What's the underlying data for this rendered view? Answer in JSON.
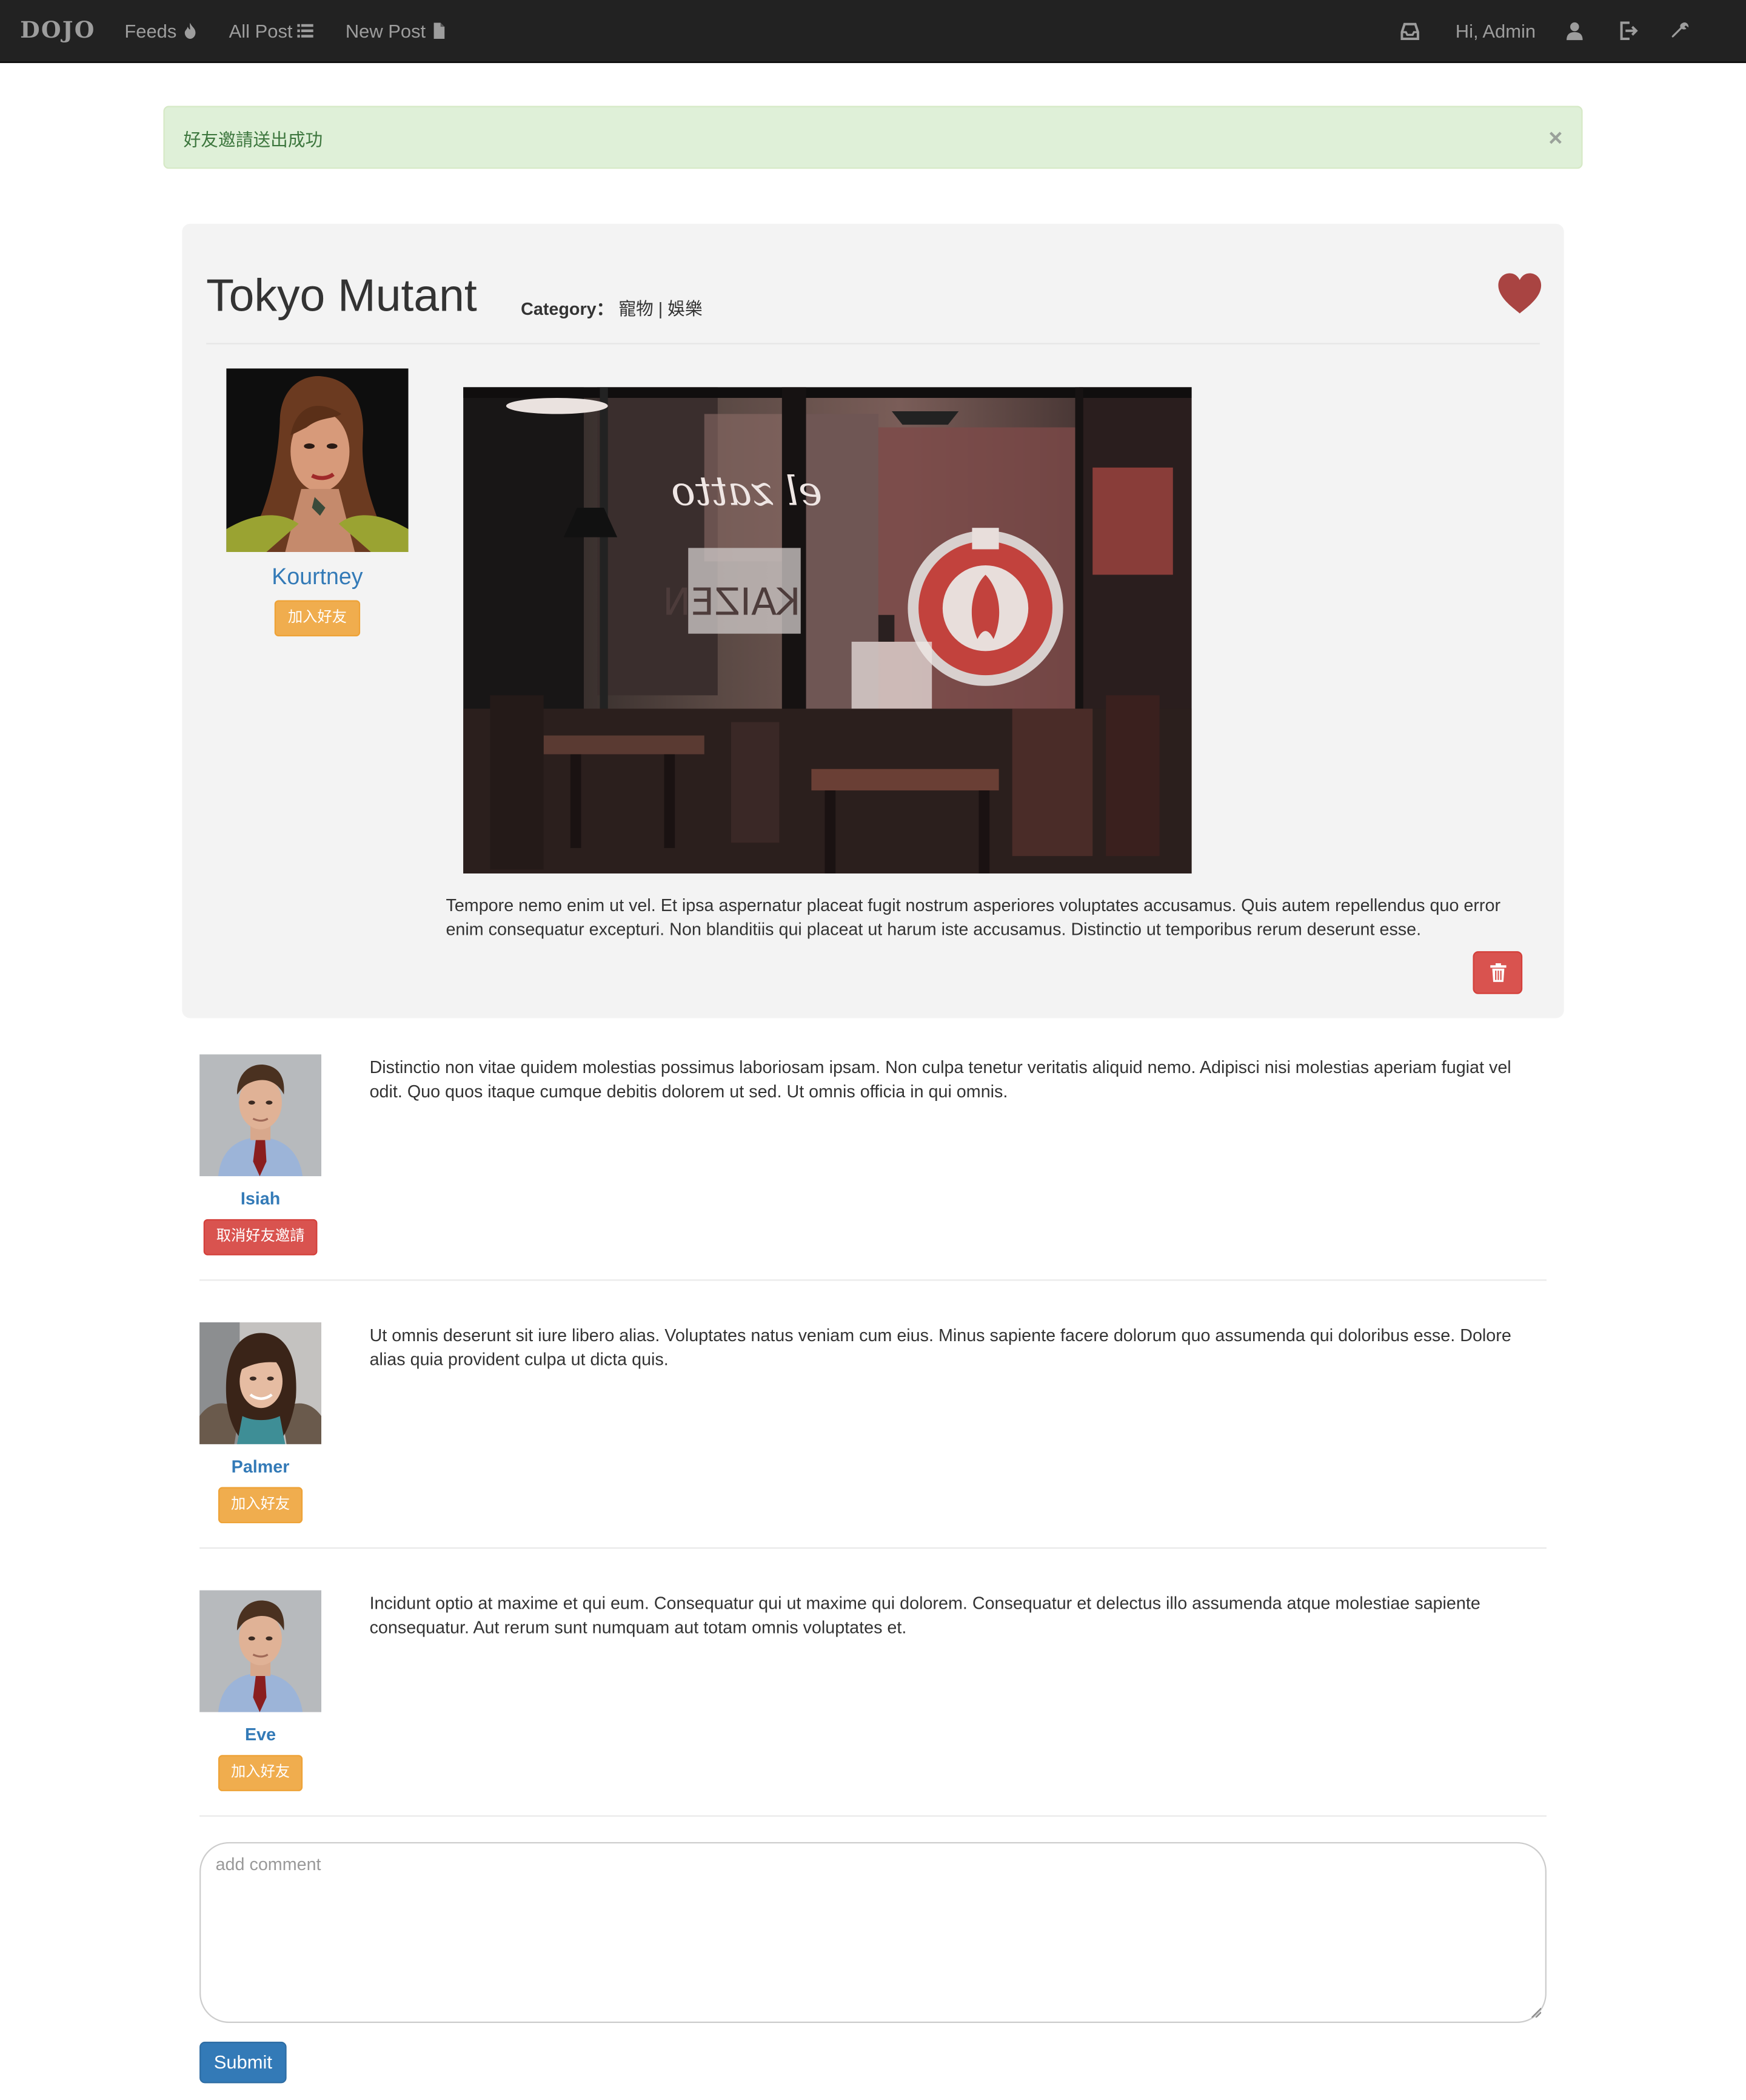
{
  "navbar": {
    "brand": "DOJO",
    "links": [
      {
        "label": "Feeds",
        "icon": "fire-icon"
      },
      {
        "label": "All Post",
        "icon": "list-icon"
      },
      {
        "label": "New Post",
        "icon": "file-icon"
      }
    ],
    "greeting": "Hi, Admin",
    "right_icons": [
      "inbox-icon",
      "user-icon",
      "logout-icon",
      "wrench-icon"
    ]
  },
  "alert": {
    "message": "好友邀請送出成功",
    "close": "×"
  },
  "post": {
    "title": "Tokyo Mutant",
    "category_label": "Category：",
    "category_value": "寵物 | 娛樂",
    "author": {
      "name": "Kourtney",
      "button": "加入好友"
    },
    "body": "Tempore nemo enim ut vel. Et ipsa aspernatur placeat fugit nostrum asperiores voluptates accusamus. Quis autem repellendus quo error enim consequatur excepturi. Non blanditiis qui placeat ut harum iste accusamus. Distinctio ut temporibus rerum deserunt esse.",
    "image_sign_text": "KAIZEN"
  },
  "comments": [
    {
      "name": "Isiah",
      "button": "取消好友邀請",
      "button_style": "danger",
      "text": "Distinctio non vitae quidem molestias possimus laboriosam ipsam. Non culpa tenetur veritatis aliquid nemo. Adipisci nisi molestias aperiam fugiat vel odit. Quo quos itaque cumque debitis dolorem ut sed. Ut omnis officia in qui omnis."
    },
    {
      "name": "Palmer",
      "button": "加入好友",
      "button_style": "warning",
      "text": "Ut omnis deserunt sit iure libero alias. Voluptates natus veniam cum eius. Minus sapiente facere dolorum quo assumenda qui doloribus esse. Dolore alias quia provident culpa ut dicta quis."
    },
    {
      "name": "Eve",
      "button": "加入好友",
      "button_style": "warning",
      "text": "Incidunt optio at maxime et qui eum. Consequatur qui ut maxime qui dolorem. Consequatur et delectus illo assumenda atque molestiae sapiente consequatur. Aut rerum sunt numquam aut totam omnis voluptates et."
    }
  ],
  "comment_form": {
    "placeholder": "add comment",
    "value": "",
    "submit": "Submit"
  },
  "colors": {
    "navbar_bg": "#222222",
    "link": "#337ab7",
    "warning": "#f0ad4e",
    "danger": "#d9534f",
    "heart": "#a94442",
    "alert_bg": "#dff0d8"
  }
}
